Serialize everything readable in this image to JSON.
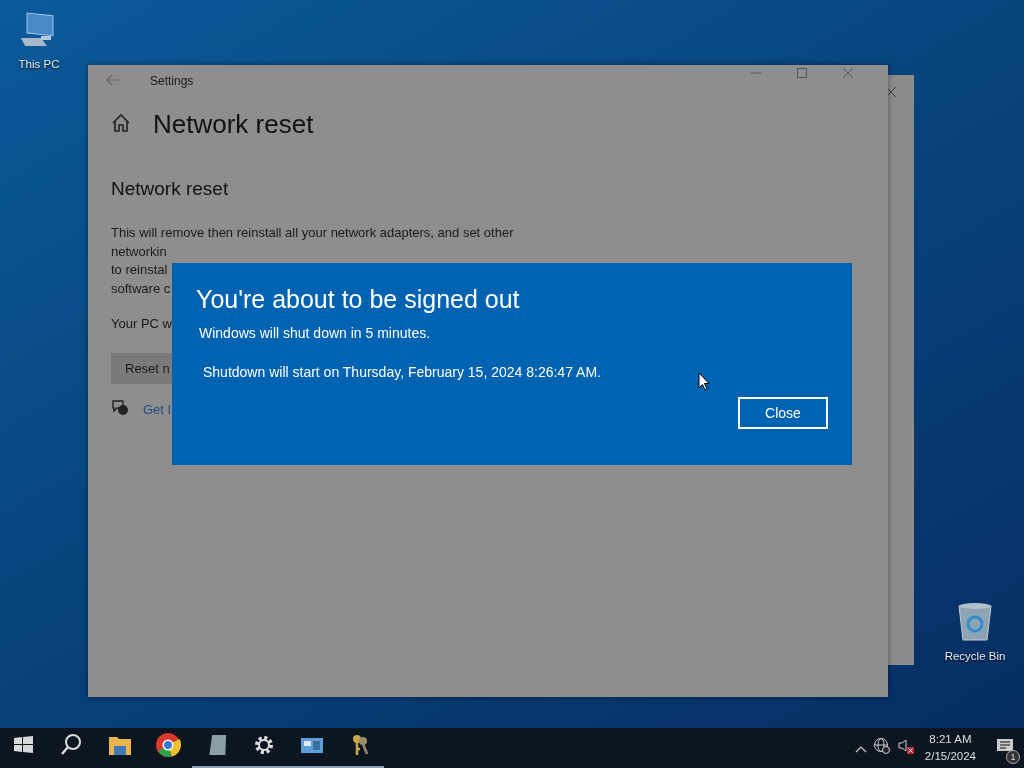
{
  "desktop": {
    "icons": [
      {
        "kind": "computer",
        "label": "This PC"
      },
      {
        "kind": "recycle-bin",
        "label": "Recycle Bin"
      }
    ]
  },
  "settings_window": {
    "title": "Settings",
    "page_title": "Network reset",
    "section_title": "Network reset",
    "description_lines": [
      "This will remove then reinstall all your network adapters, and set other",
      "networkin",
      "to reinstal",
      "software c"
    ],
    "status_text": "Your PC w",
    "reset_button": "Reset n",
    "help_link": "Get I"
  },
  "dialog": {
    "title": "You're about to be signed out",
    "message": "Windows will shut down in 5 minutes.",
    "detail": "Shutdown will start on Thursday, February 15, 2024 8:26:47 AM.",
    "button": "Close"
  },
  "taskbar": {
    "apps": [
      {
        "kind": "start",
        "running": false
      },
      {
        "kind": "search",
        "running": false
      },
      {
        "kind": "folder",
        "running": false
      },
      {
        "kind": "chrome",
        "running": false
      },
      {
        "kind": "notepad",
        "running": true
      },
      {
        "kind": "gear",
        "running": true
      },
      {
        "kind": "panel",
        "running": true
      },
      {
        "kind": "keys",
        "running": true
      }
    ],
    "time": "8:21 AM",
    "date": "2/15/2024",
    "notification_count": "1"
  }
}
